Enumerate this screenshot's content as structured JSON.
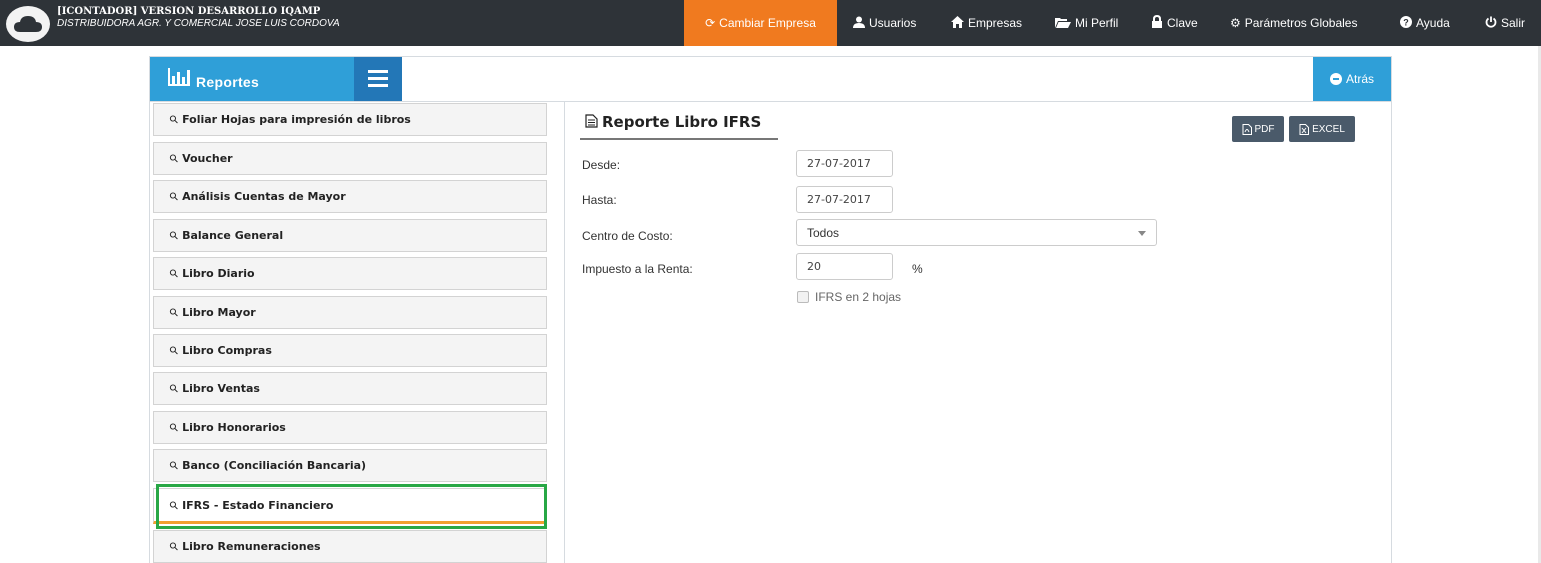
{
  "app": {
    "role_line": "[ICONTADOR] VERSION DESARROLLO IQAMP",
    "company_line": "DISTRIBUIDORA AGR. Y COMERCIAL JOSE LUIS CORDOVA"
  },
  "nav": [
    {
      "label": "Cambiar Empresa",
      "icon": "refresh-icon",
      "glyph": "⟳",
      "active": true
    },
    {
      "label": "Usuarios",
      "icon": "user-icon",
      "glyph": "👤"
    },
    {
      "label": "Empresas",
      "icon": "home-icon",
      "glyph": "⌂"
    },
    {
      "label": "Mi Perfil",
      "icon": "folder-open-icon",
      "glyph": "🗁"
    },
    {
      "label": "Clave",
      "icon": "lock-icon",
      "glyph": "🔒"
    },
    {
      "label": "Parámetros Globales",
      "icon": "gear-icon",
      "glyph": "⚙"
    },
    {
      "label": "Ayuda",
      "icon": "question-icon",
      "glyph": "❓"
    },
    {
      "label": "Salir",
      "icon": "power-icon",
      "glyph": "⏻"
    }
  ],
  "header": {
    "title": "Reportes",
    "back_label": "Atrás"
  },
  "reports": [
    "Foliar Hojas para impresión de libros",
    "Voucher",
    "Análisis Cuentas de Mayor",
    "Balance General",
    "Libro Diario",
    "Libro Mayor",
    "Libro Compras",
    "Libro Ventas",
    "Libro Honorarios",
    "Banco (Conciliación Bancaria)",
    "IFRS - Estado Financiero",
    "Libro Remuneraciones"
  ],
  "active_report_index": 10,
  "form": {
    "title": "Reporte Libro IFRS",
    "pdf_label": "PDF",
    "excel_label": "EXCEL",
    "desde_label": "Desde:",
    "desde_value": "27-07-2017",
    "hasta_label": "Hasta:",
    "hasta_value": "27-07-2017",
    "centro_label": "Centro de Costo:",
    "centro_value": "Todos",
    "impuesto_label": "Impuesto a la Renta:",
    "impuesto_value": "20",
    "impuesto_unit": "%",
    "ifrs_checkbox_label": "IFRS en 2 hojas",
    "ifrs_checkbox_checked": false
  },
  "colors": {
    "topbar": "#2e3338",
    "active_nav": "#f07a1f",
    "accent_blue": "#2f9fd8",
    "menu_blue": "#2377b7",
    "highlight_green": "#28a745"
  }
}
